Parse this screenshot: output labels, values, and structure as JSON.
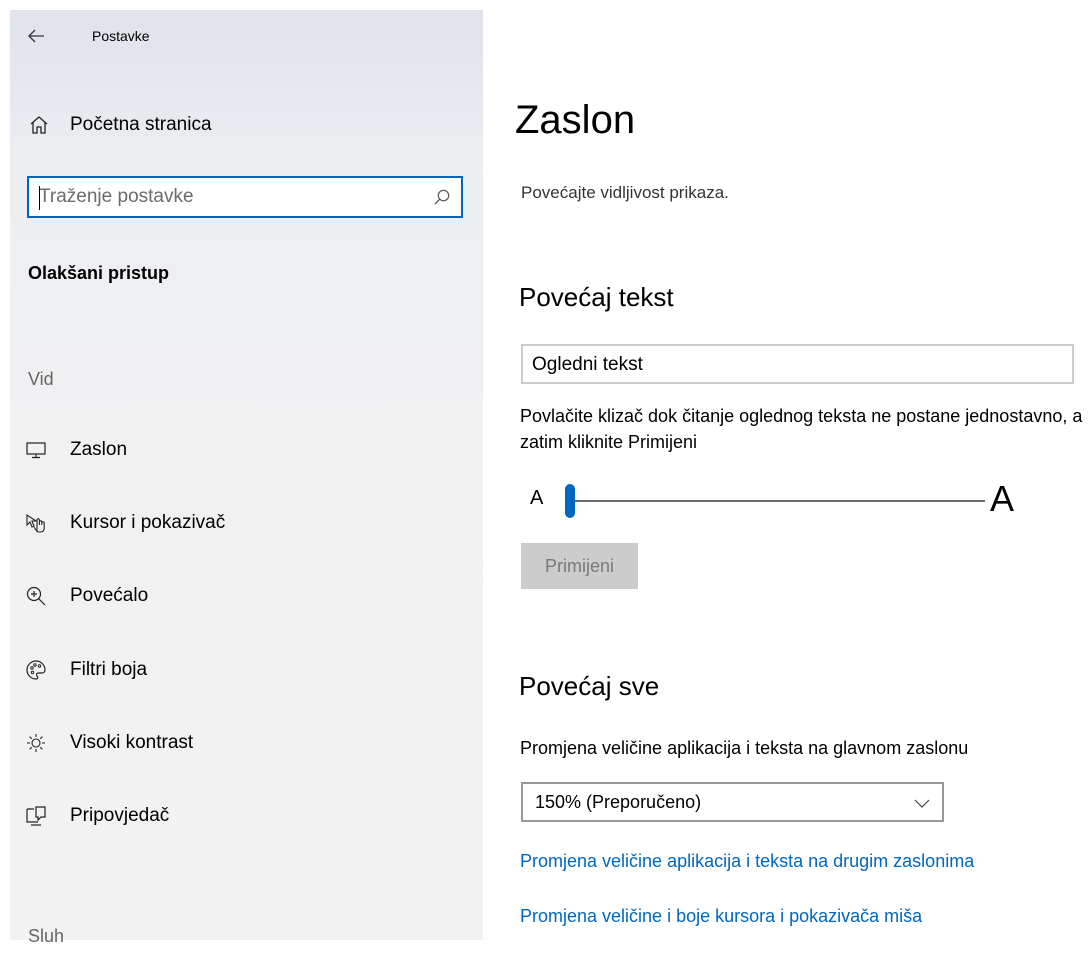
{
  "sidebar": {
    "app_title": "Postavke",
    "back_icon": "back-arrow-icon",
    "home_label": "Početna stranica",
    "search": {
      "placeholder": "Traženje postavke",
      "value": ""
    },
    "section": "Olakšani pristup",
    "group_vision": "Vid",
    "items": [
      {
        "label": "Zaslon",
        "icon": "monitor-icon",
        "selected": true
      },
      {
        "label": "Kursor i pokazivač",
        "icon": "cursor-icon"
      },
      {
        "label": "Povećalo",
        "icon": "magnifier-icon"
      },
      {
        "label": "Filtri boja",
        "icon": "palette-icon"
      },
      {
        "label": "Visoki kontrast",
        "icon": "brightness-icon"
      },
      {
        "label": "Pripovjedač",
        "icon": "narrator-icon"
      }
    ],
    "group_hearing": "Sluh"
  },
  "main": {
    "title": "Zaslon",
    "subtitle": "Povećajte vidljivost prikaza.",
    "text_size": {
      "heading": "Povećaj tekst",
      "sample": "Ogledni tekst",
      "description": "Povlačite klizač dok čitanje oglednog teksta ne postane jednostavno, a zatim kliknite Primijeni",
      "small_a": "A",
      "large_a": "A",
      "slider_value": 0,
      "apply_label": "Primijeni"
    },
    "scale": {
      "heading": "Povećaj sve",
      "label": "Promjena veličine aplikacija i teksta na glavnom zaslonu",
      "selected": "150% (Preporučeno)",
      "link_other_displays": "Promjena veličine aplikacija i teksta na drugim zaslonima",
      "link_cursor": "Promjena veličine i boje kursora i pokazivača miša"
    }
  },
  "colors": {
    "accent": "#0067c0",
    "sidebar_bg": "#f2f2f2"
  }
}
